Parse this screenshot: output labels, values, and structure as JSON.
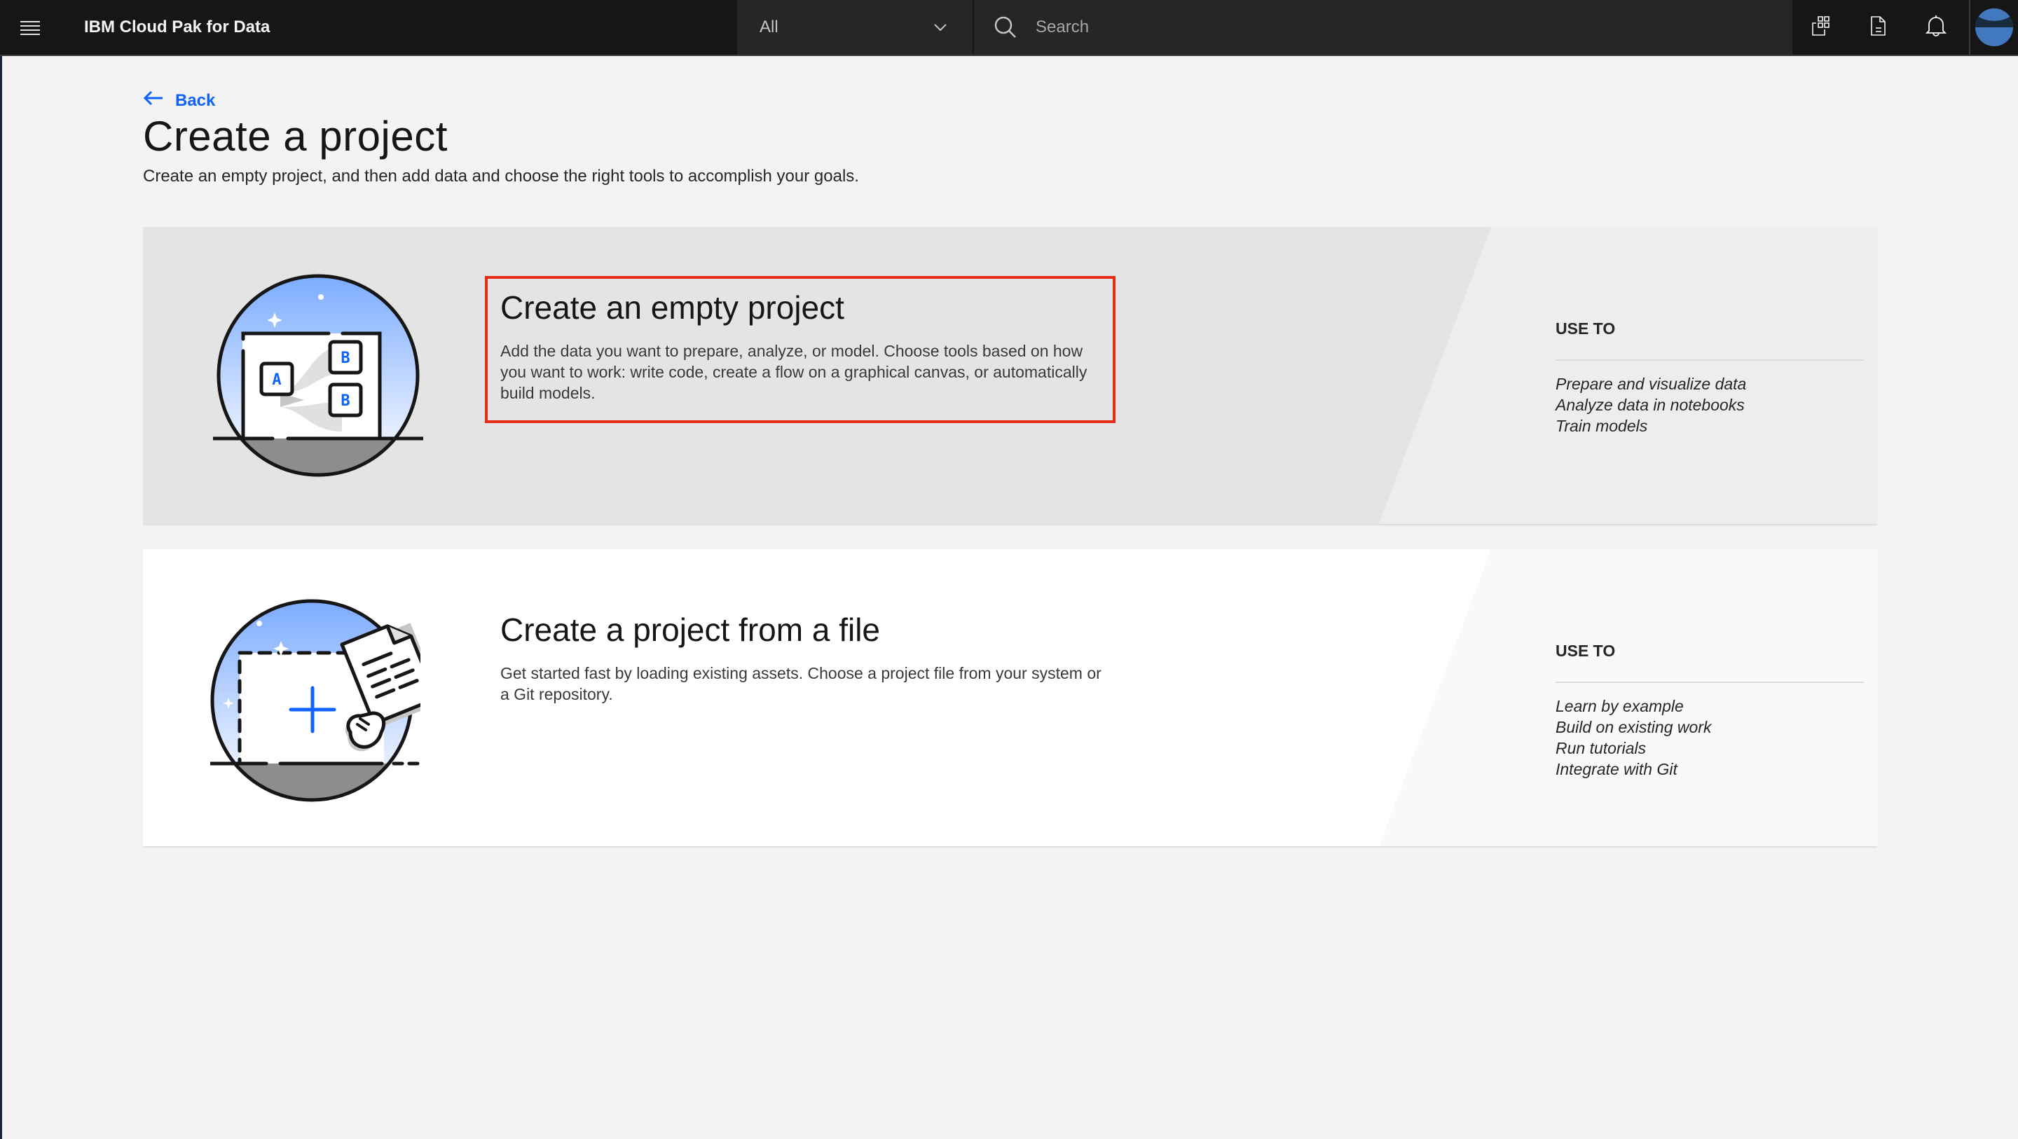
{
  "app": {
    "title": "IBM Cloud Pak for Data"
  },
  "topbar": {
    "scope_selected": "All",
    "search_placeholder": "Search",
    "actions": [
      {
        "icon": "catalog-icon",
        "label": "Apps"
      },
      {
        "icon": "document-icon",
        "label": "Documentation"
      },
      {
        "icon": "bell-icon",
        "label": "Notifications"
      }
    ],
    "avatar_color": "#4178be"
  },
  "page": {
    "back_label": "Back",
    "title": "Create a project",
    "subtitle": "Create an empty project, and then add data and choose the right tools to accomplish your goals."
  },
  "tiles": [
    {
      "title": "Create an empty project",
      "description": "Add the data you want to prepare, analyze, or model. Choose tools based on how you want to work: write code, create a flow on a graphical canvas, or automatically build models.",
      "use_to_label": "USE TO",
      "use_to": [
        "Prepare and visualize data",
        "Analyze data in notebooks",
        "Train models"
      ],
      "illustration_labels": [
        "A",
        "B",
        "B"
      ],
      "highlighted": true
    },
    {
      "title": "Create a project from a file",
      "description": "Get started fast by loading existing assets. Choose a project file from your system or a Git repository.",
      "use_to_label": "USE TO",
      "use_to": [
        "Learn by example",
        "Build on existing work",
        "Run tutorials",
        "Integrate with Git"
      ],
      "highlighted": false
    }
  ],
  "colors": {
    "accent": "#0f62fe",
    "highlight_border": "#e52b16",
    "header_bg": "#161616"
  }
}
